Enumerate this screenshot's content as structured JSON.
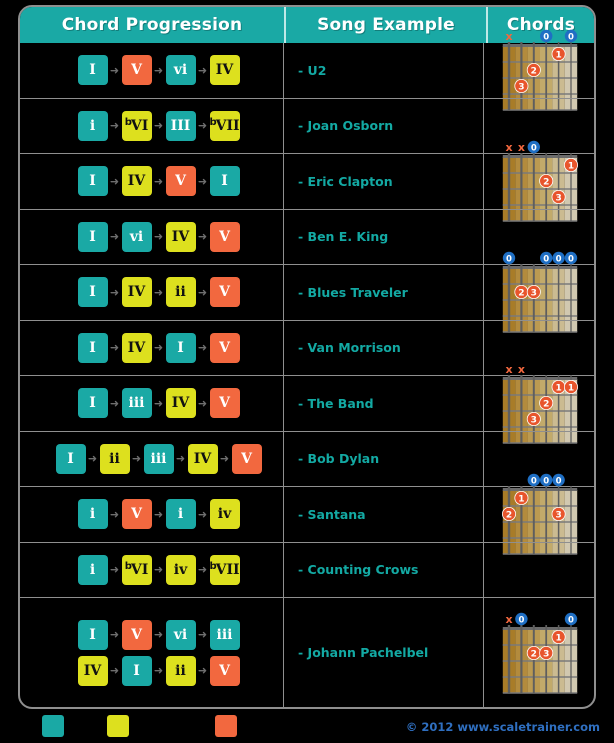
{
  "header": {
    "col1": "Chord Progression",
    "col2": "Song Example",
    "col3": "Chords"
  },
  "colors": {
    "teal": "#1aa9a5",
    "yellow": "#dde01e",
    "orange": "#f2683f",
    "header_bg": "#1aa9a5",
    "background": "#000000",
    "border": "#8f8f8f",
    "song_text": "#13a9a3",
    "copyright_text": "#2f6fc0",
    "marker_finger": "#f2683f",
    "marker_open": "#1f6fc4",
    "marker_mute": "#f2683f"
  },
  "rows": [
    {
      "lines": [
        [
          {
            "label": "I",
            "color": "teal"
          },
          {
            "label": "V",
            "color": "orange"
          },
          {
            "label": "vi",
            "color": "teal"
          },
          {
            "label": "IV",
            "color": "yellow"
          }
        ]
      ],
      "song": "- U2"
    },
    {
      "lines": [
        [
          {
            "label": "i",
            "color": "teal"
          },
          {
            "label": "VI",
            "flat": true,
            "color": "yellow"
          },
          {
            "label": "III",
            "color": "teal"
          },
          {
            "label": "VII",
            "flat": true,
            "color": "yellow"
          }
        ]
      ],
      "song": "- Joan Osborn"
    },
    {
      "lines": [
        [
          {
            "label": "I",
            "color": "teal"
          },
          {
            "label": "IV",
            "color": "yellow"
          },
          {
            "label": "V",
            "color": "orange"
          },
          {
            "label": "I",
            "color": "teal"
          }
        ]
      ],
      "song": "- Eric Clapton"
    },
    {
      "lines": [
        [
          {
            "label": "I",
            "color": "teal"
          },
          {
            "label": "vi",
            "color": "teal"
          },
          {
            "label": "IV",
            "color": "yellow"
          },
          {
            "label": "V",
            "color": "orange"
          }
        ]
      ],
      "song": "- Ben E. King"
    },
    {
      "lines": [
        [
          {
            "label": "I",
            "color": "teal"
          },
          {
            "label": "IV",
            "color": "yellow"
          },
          {
            "label": "ii",
            "color": "yellow"
          },
          {
            "label": "V",
            "color": "orange"
          }
        ]
      ],
      "song": "- Blues Traveler"
    },
    {
      "lines": [
        [
          {
            "label": "I",
            "color": "teal"
          },
          {
            "label": "IV",
            "color": "yellow"
          },
          {
            "label": "I",
            "color": "teal"
          },
          {
            "label": "V",
            "color": "orange"
          }
        ]
      ],
      "song": "- Van Morrison"
    },
    {
      "lines": [
        [
          {
            "label": "I",
            "color": "teal"
          },
          {
            "label": "iii",
            "color": "teal"
          },
          {
            "label": "IV",
            "color": "yellow"
          },
          {
            "label": "V",
            "color": "orange"
          }
        ]
      ],
      "song": "- The Band"
    },
    {
      "lines": [
        [
          {
            "label": "I",
            "color": "teal"
          },
          {
            "label": "ii",
            "color": "yellow"
          },
          {
            "label": "iii",
            "color": "teal"
          },
          {
            "label": "IV",
            "color": "yellow"
          },
          {
            "label": "V",
            "color": "orange"
          }
        ]
      ],
      "song": "- Bob Dylan"
    },
    {
      "lines": [
        [
          {
            "label": "i",
            "color": "teal"
          },
          {
            "label": "V",
            "color": "orange"
          },
          {
            "label": "i",
            "color": "teal"
          },
          {
            "label": "iv",
            "color": "yellow"
          }
        ]
      ],
      "song": "- Santana"
    },
    {
      "lines": [
        [
          {
            "label": "i",
            "color": "teal"
          },
          {
            "label": "VI",
            "flat": true,
            "color": "yellow"
          },
          {
            "label": "iv",
            "color": "yellow"
          },
          {
            "label": "VII",
            "flat": true,
            "color": "yellow"
          }
        ]
      ],
      "song": "- Counting Crows"
    },
    {
      "lines": [
        [
          {
            "label": "I",
            "color": "teal"
          },
          {
            "label": "V",
            "color": "orange"
          },
          {
            "label": "vi",
            "color": "teal"
          },
          {
            "label": "iii",
            "color": "teal"
          }
        ],
        [
          {
            "label": "IV",
            "color": "yellow"
          },
          {
            "label": "I",
            "color": "teal"
          },
          {
            "label": "ii",
            "color": "yellow"
          },
          {
            "label": "V",
            "color": "orange"
          }
        ]
      ],
      "song": "- Johann Pachelbel"
    }
  ],
  "chord_diagrams": [
    {
      "name": "chord-diagram-1",
      "row_index": 0,
      "top_markers": [
        "x",
        "",
        "",
        "0",
        "",
        "0"
      ],
      "fingers": [
        {
          "string": 5,
          "fret": 1,
          "finger": "1"
        },
        {
          "string": 3,
          "fret": 2,
          "finger": "2"
        },
        {
          "string": 2,
          "fret": 3,
          "finger": "3"
        }
      ]
    },
    {
      "name": "chord-diagram-2",
      "row_index": 2,
      "top_markers": [
        "x",
        "x",
        "0",
        "",
        "",
        ""
      ],
      "fingers": [
        {
          "string": 6,
          "fret": 1,
          "finger": "1"
        },
        {
          "string": 4,
          "fret": 2,
          "finger": "2"
        },
        {
          "string": 5,
          "fret": 3,
          "finger": "3"
        }
      ]
    },
    {
      "name": "chord-diagram-3",
      "row_index": 4,
      "top_markers": [
        "0",
        "",
        "",
        "0",
        "0",
        "0"
      ],
      "fingers": [
        {
          "string": 2,
          "fret": 2,
          "finger": "2"
        },
        {
          "string": 3,
          "fret": 2,
          "finger": "3"
        }
      ]
    },
    {
      "name": "chord-diagram-4",
      "row_index": 6,
      "top_markers": [
        "x",
        "x",
        "",
        "",
        "",
        ""
      ],
      "fingers": [
        {
          "string": 5,
          "fret": 1,
          "finger": "1"
        },
        {
          "string": 6,
          "fret": 1,
          "finger": "1"
        },
        {
          "string": 4,
          "fret": 2,
          "finger": "2"
        },
        {
          "string": 3,
          "fret": 3,
          "finger": "3"
        }
      ]
    },
    {
      "name": "chord-diagram-5",
      "row_index": 8,
      "top_markers": [
        "",
        "",
        "0",
        "0",
        "0",
        ""
      ],
      "fingers": [
        {
          "string": 2,
          "fret": 1,
          "finger": "1"
        },
        {
          "string": 1,
          "fret": 2,
          "finger": "2"
        },
        {
          "string": 5,
          "fret": 2,
          "finger": "3"
        }
      ]
    },
    {
      "name": "chord-diagram-6",
      "row_index": 10,
      "top_markers": [
        "x",
        "0",
        "",
        "",
        "",
        "0"
      ],
      "fingers": [
        {
          "string": 5,
          "fret": 1,
          "finger": "1"
        },
        {
          "string": 3,
          "fret": 2,
          "finger": "2"
        },
        {
          "string": 4,
          "fret": 2,
          "finger": "3"
        }
      ]
    }
  ],
  "footer": {
    "swatches": [
      "#1aa9a5",
      "#dde01e",
      "#f2683f"
    ],
    "copyright": "© 2012 www.scaletrainer.com"
  }
}
